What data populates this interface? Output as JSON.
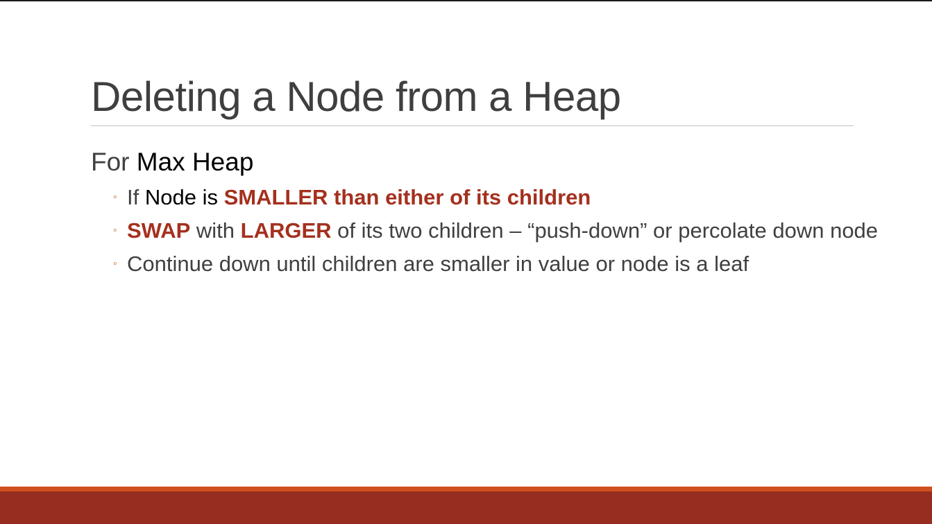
{
  "slide": {
    "title": "Deleting a Node from a Heap",
    "level1": {
      "prefix": "For ",
      "emphasis": "Max Heap"
    },
    "bullets": [
      {
        "glyph": "◦",
        "parts": [
          "If ",
          "Node is",
          " ",
          "SMALLER than either of its children"
        ]
      },
      {
        "glyph": "◦",
        "parts": [
          "SWAP",
          " with ",
          "LARGER",
          " of its two children – “push-down” or percolate down node"
        ]
      },
      {
        "glyph": "◦",
        "parts": [
          "Continue down until children are smaller in value or node is a leaf"
        ]
      }
    ]
  },
  "colors": {
    "title": "#3f3f3f",
    "body_text": "#404040",
    "emphasis_black": "#000000",
    "emphasis_red": "#a4301e",
    "bullet_orange": "#c55a11",
    "footer_accent": "#d0501f",
    "footer_bar": "#972d20"
  }
}
